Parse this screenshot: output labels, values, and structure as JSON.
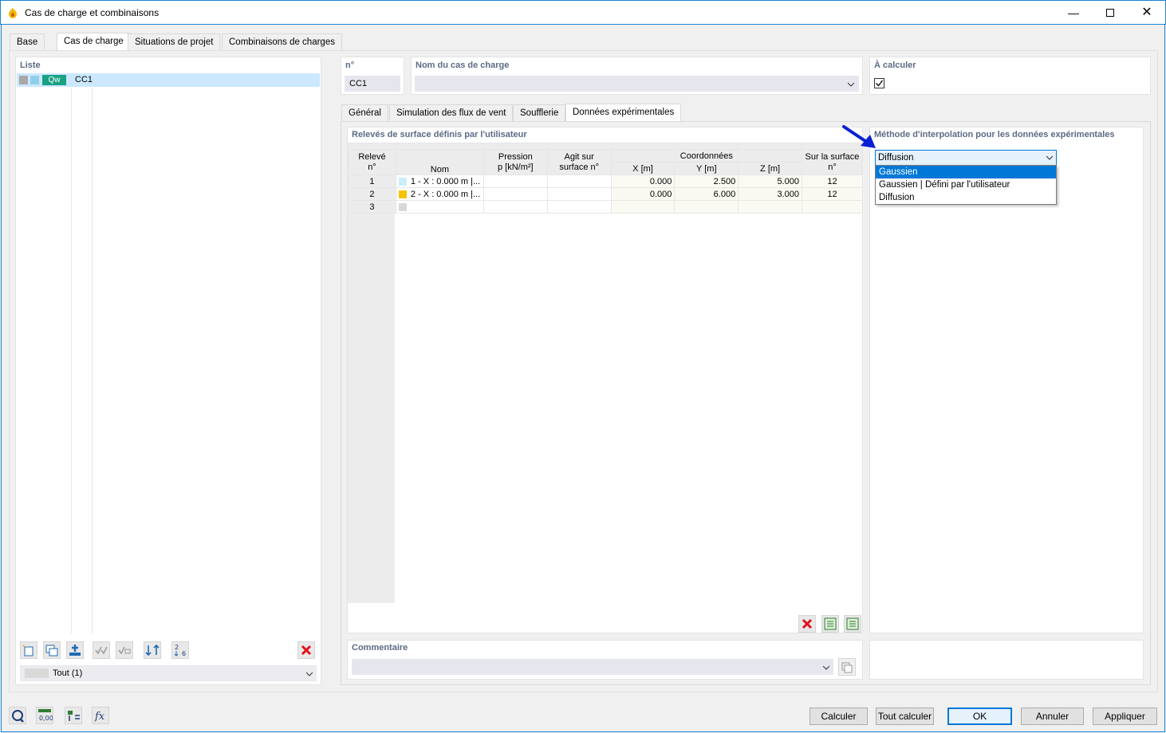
{
  "window": {
    "title": "Cas de charge et combinaisons"
  },
  "main_tabs": [
    "Base",
    "Cas de charge",
    "Situations de projet",
    "Combinaisons de charges"
  ],
  "list_panel": {
    "label": "Liste",
    "item": {
      "badge": "Qw",
      "name": "CC1"
    },
    "filter": "Tout (1)"
  },
  "header": {
    "no_label": "n°",
    "no_value": "CC1",
    "name_label": "Nom du cas de charge",
    "name_value": "",
    "calc_label": "À calculer",
    "calc_checked": true
  },
  "sub_tabs": [
    "Général",
    "Simulation des flux de vent",
    "Soufflerie",
    "Données expérimentales"
  ],
  "table": {
    "title": "Relevés de surface définis par l'utilisateur",
    "headers": {
      "releve": "Relevé",
      "releve2": "n°",
      "nom": "Nom",
      "pression": "Pression",
      "pression2": "p [kN/m²]",
      "agit": "Agit sur",
      "agit2": "surface n°",
      "coord": "Coordonnées",
      "x": "X [m]",
      "y": "Y [m]",
      "z": "Z [m]",
      "surf": "Sur la surface",
      "surf2": "n°"
    },
    "rows": [
      {
        "no": "1",
        "color": "#c9eef6",
        "nom": "1 - X : 0.000 m |...",
        "pression": "",
        "agit": "",
        "x": "0.000",
        "y": "2.500",
        "z": "5.000",
        "surf": "12"
      },
      {
        "no": "2",
        "color": "#f5c400",
        "nom": "2 - X : 0.000 m |...",
        "pression": "",
        "agit": "",
        "x": "0.000",
        "y": "6.000",
        "z": "3.000",
        "surf": "12"
      },
      {
        "no": "3",
        "color": "#d9d9d9",
        "nom": "",
        "pression": "",
        "agit": "",
        "x": "",
        "y": "",
        "z": "",
        "surf": ""
      }
    ]
  },
  "interp": {
    "label": "Méthode d'interpolation pour les données expérimentales",
    "selected": "Diffusion",
    "options": [
      "Gaussien",
      "Gaussien | Défini par l'utilisateur",
      "Diffusion"
    ],
    "highlighted": "Gaussien"
  },
  "comment": {
    "label": "Commentaire",
    "value": ""
  },
  "buttons": {
    "calculer": "Calculer",
    "tout_calculer": "Tout calculer",
    "ok": "OK",
    "annuler": "Annuler",
    "appliquer": "Appliquer"
  },
  "colors": {
    "accent": "#0078d7",
    "badge": "#1aa183",
    "arrow": "#0a1fd6",
    "delete": "#e0141e"
  }
}
